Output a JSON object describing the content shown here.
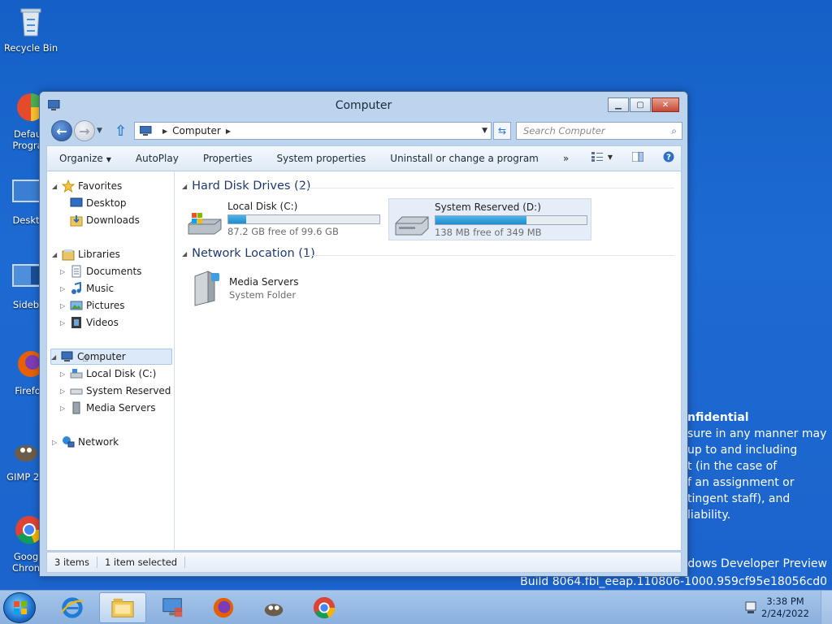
{
  "desktop": {
    "icons": [
      {
        "label": "Recycle Bin"
      },
      {
        "label": "Defau\nProgra"
      },
      {
        "label": "Deskt"
      },
      {
        "label": "Sideb"
      },
      {
        "label": "Firefo"
      },
      {
        "label": "GIMP 2."
      },
      {
        "label": "Goog\nChron"
      }
    ],
    "watermark": {
      "title": "nfidential",
      "lines": [
        "sure in any manner may",
        "up to and including",
        "t (in the case of",
        "f an assignment or",
        "tingent staff), and",
        "liability."
      ],
      "build_line1": "ndows Developer Preview",
      "build_line2": "Build 8064.fbl_eeap.110806-1000.959cf95e18056cd0"
    }
  },
  "window": {
    "title": "Computer",
    "address": {
      "crumb": "Computer"
    },
    "search": {
      "placeholder": "Search Computer"
    },
    "commands": {
      "organize": "Organize",
      "autoplay": "AutoPlay",
      "properties": "Properties",
      "system_properties": "System properties",
      "uninstall": "Uninstall or change a program",
      "more": "»"
    },
    "nav": {
      "favorites": "Favorites",
      "desktop": "Desktop",
      "downloads": "Downloads",
      "libraries": "Libraries",
      "documents": "Documents",
      "music": "Music",
      "pictures": "Pictures",
      "videos": "Videos",
      "computer": "Computer",
      "local_disk": "Local Disk (C:)",
      "system_reserved": "System Reserved (D:",
      "media_servers": "Media Servers",
      "network": "Network"
    },
    "groups": {
      "hdd": "Hard Disk Drives (2)",
      "net": "Network Location (1)"
    },
    "drives": [
      {
        "name": "Local Disk (C:)",
        "free": "87.2 GB free of 99.6 GB",
        "used_fraction": 0.12
      },
      {
        "name": "System Reserved (D:)",
        "free": "138 MB free of 349 MB",
        "used_fraction": 0.6
      }
    ],
    "network_item": {
      "name": "Media Servers",
      "sub": "System Folder"
    },
    "status": {
      "items": "3 items",
      "selected": "1 item selected"
    }
  },
  "taskbar": {
    "time": "3:38 PM",
    "date": "2/24/2022"
  },
  "colors": {
    "accent": "#1e8ccd",
    "desktop": "#1d6ad2"
  }
}
